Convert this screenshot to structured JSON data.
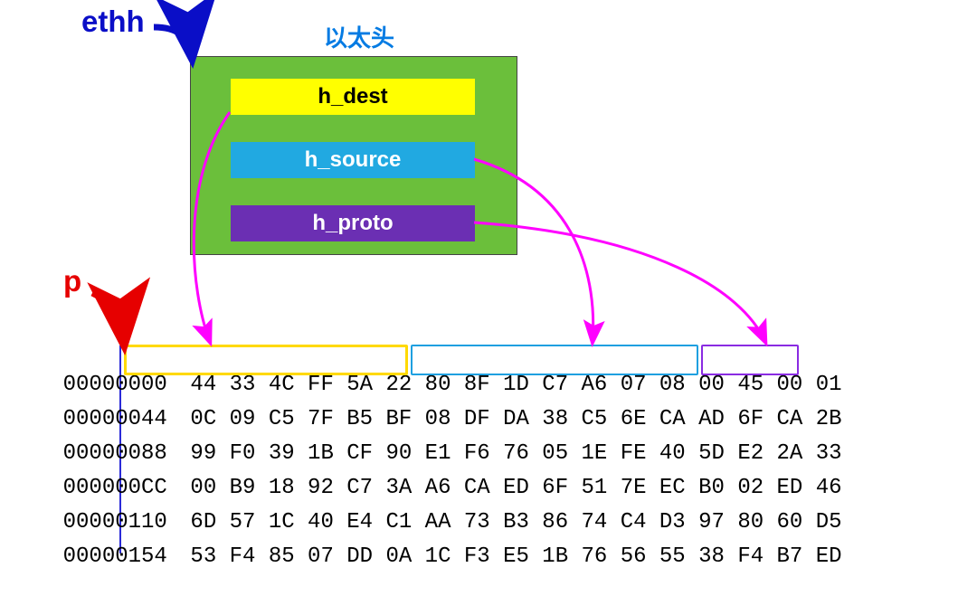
{
  "labels": {
    "ethh": "ethh",
    "p": "p",
    "title": "以太头"
  },
  "fields": {
    "dest": "h_dest",
    "source": "h_source",
    "proto": "h_proto"
  },
  "hex_offsets": [
    "00000000",
    "00000044",
    "00000088",
    "000000CC",
    "00000110",
    "00000154"
  ],
  "hex_rows": [
    "44 33 4C FF 5A 22 80 8F 1D C7 A6 07 08 00 45 00 01",
    "0C 09 C5 7F B5 BF 08 DF DA 38 C5 6E CA AD 6F CA 2B",
    "99 F0 39 1B CF 90 E1 F6 76 05 1E FE 40 5D E2 2A 33",
    "00 B9 18 92 C7 3A A6 CA ED 6F 51 7E EC B0 02 ED 46",
    "6D 57 1C 40 E4 C1 AA 73 B3 86 74 C4 D3 97 80 60 D5",
    "53 F4 85 07 DD 0A 1C F3 E5 1B 76 56 55 38 F4 B7 ED"
  ],
  "colors": {
    "ethh": "#0a0ec7",
    "p": "#e60000",
    "title": "#057be3",
    "struct_bg": "#6bbf3b",
    "dest_bg": "#ffff00",
    "source_bg": "#21a9e1",
    "proto_bg": "#6b2fb3",
    "arrow_ptr": "#ff00ff"
  }
}
